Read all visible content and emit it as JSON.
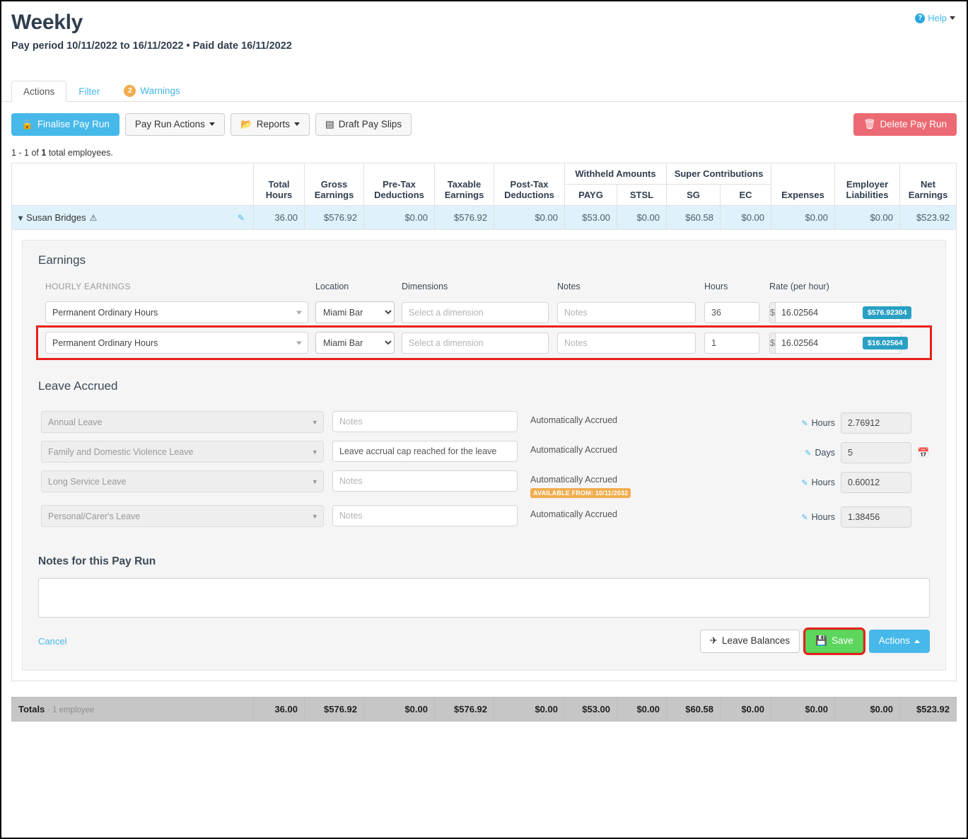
{
  "header": {
    "title": "Weekly",
    "subtitle": "Pay period 10/11/2022 to 16/11/2022 • Paid date 16/11/2022",
    "help_label": "Help"
  },
  "tabs": [
    {
      "label": "Actions",
      "active": true
    },
    {
      "label": "Filter",
      "active": false
    },
    {
      "label": "Warnings",
      "active": false,
      "badge": "2"
    }
  ],
  "toolbar": {
    "finalise_label": "Finalise Pay Run",
    "pay_run_actions_label": "Pay Run Actions",
    "reports_label": "Reports",
    "draft_pay_slips_label": "Draft Pay Slips",
    "delete_label": "Delete Pay Run"
  },
  "count_line": {
    "prefix": "1 - 1 of ",
    "count": "1",
    "suffix": " total employees."
  },
  "table": {
    "group_headers": [
      {
        "label": "Withheld Amounts"
      },
      {
        "label": "Super Contributions"
      }
    ],
    "columns": [
      "Total Hours",
      "Gross Earnings",
      "Pre-Tax Deductions",
      "Taxable Earnings",
      "Post-Tax Deductions",
      "PAYG",
      "STSL",
      "SG",
      "EC",
      "Expenses",
      "Employer Liabilities",
      "Net Earnings"
    ],
    "employee": {
      "name": "Susan Bridges",
      "values": [
        "36.00",
        "$576.92",
        "$0.00",
        "$576.92",
        "$0.00",
        "$53.00",
        "$0.00",
        "$60.58",
        "$0.00",
        "$0.00",
        "$0.00",
        "$523.92"
      ]
    },
    "totals": {
      "label": "Totals",
      "sublabel": "· 1 employee",
      "values": [
        "36.00",
        "$576.92",
        "$0.00",
        "$576.92",
        "$0.00",
        "$53.00",
        "$0.00",
        "$60.58",
        "$0.00",
        "$0.00",
        "$0.00",
        "$523.92"
      ]
    }
  },
  "earnings": {
    "section_title": "Earnings",
    "labels": {
      "hourly": "HOURLY EARNINGS",
      "location": "Location",
      "dimensions": "Dimensions",
      "notes": "Notes",
      "hours": "Hours",
      "rate": "Rate (per hour)"
    },
    "rows": [
      {
        "pay_category": "Permanent Ordinary Hours",
        "location": "Miami Bar",
        "dimension_placeholder": "Select a dimension",
        "notes_placeholder": "Notes",
        "notes_value": "",
        "hours": "36",
        "currency_symbol": "$",
        "rate": "16.02564",
        "amount": "$576.92304",
        "highlighted": false
      },
      {
        "pay_category": "Permanent Ordinary Hours",
        "location": "Miami Bar",
        "dimension_placeholder": "Select a dimension",
        "notes_placeholder": "Notes",
        "notes_value": "",
        "hours": "1",
        "currency_symbol": "$",
        "rate": "16.02564",
        "amount": "$16.02564",
        "highlighted": true
      }
    ]
  },
  "leave": {
    "section_title": "Leave Accrued",
    "rows": [
      {
        "type": "Annual Leave",
        "notes_placeholder": "Notes",
        "notes_value": "",
        "status": "Automatically Accrued",
        "unit": "Hours",
        "value": "2.76912",
        "badge": "",
        "has_calendar": false
      },
      {
        "type": "Family and Domestic Violence Leave",
        "notes_placeholder": "Notes",
        "notes_value": "Leave accrual cap reached for the leave",
        "status": "Automatically Accrued",
        "unit": "Days",
        "value": "5",
        "badge": "",
        "has_calendar": true
      },
      {
        "type": "Long Service Leave",
        "notes_placeholder": "Notes",
        "notes_value": "",
        "status": "Automatically Accrued",
        "unit": "Hours",
        "value": "0.60012",
        "badge": "AVAILABLE FROM: 10/11/2032",
        "has_calendar": false
      },
      {
        "type": "Personal/Carer's Leave",
        "notes_placeholder": "Notes",
        "notes_value": "",
        "status": "Automatically Accrued",
        "unit": "Hours",
        "value": "1.38456",
        "badge": "",
        "has_calendar": false
      }
    ]
  },
  "notes": {
    "title": "Notes for this Pay Run",
    "value": "",
    "placeholder": ""
  },
  "footer": {
    "cancel_label": "Cancel",
    "leave_balances_label": "Leave Balances",
    "save_label": "Save",
    "actions_label": "Actions"
  },
  "colors": {
    "accent": "#46b8e9",
    "danger": "#ec6a73",
    "success": "#5cd65c",
    "warning": "#f0ad4e",
    "badge": "#29a0c4",
    "highlight": "#e8201a"
  }
}
